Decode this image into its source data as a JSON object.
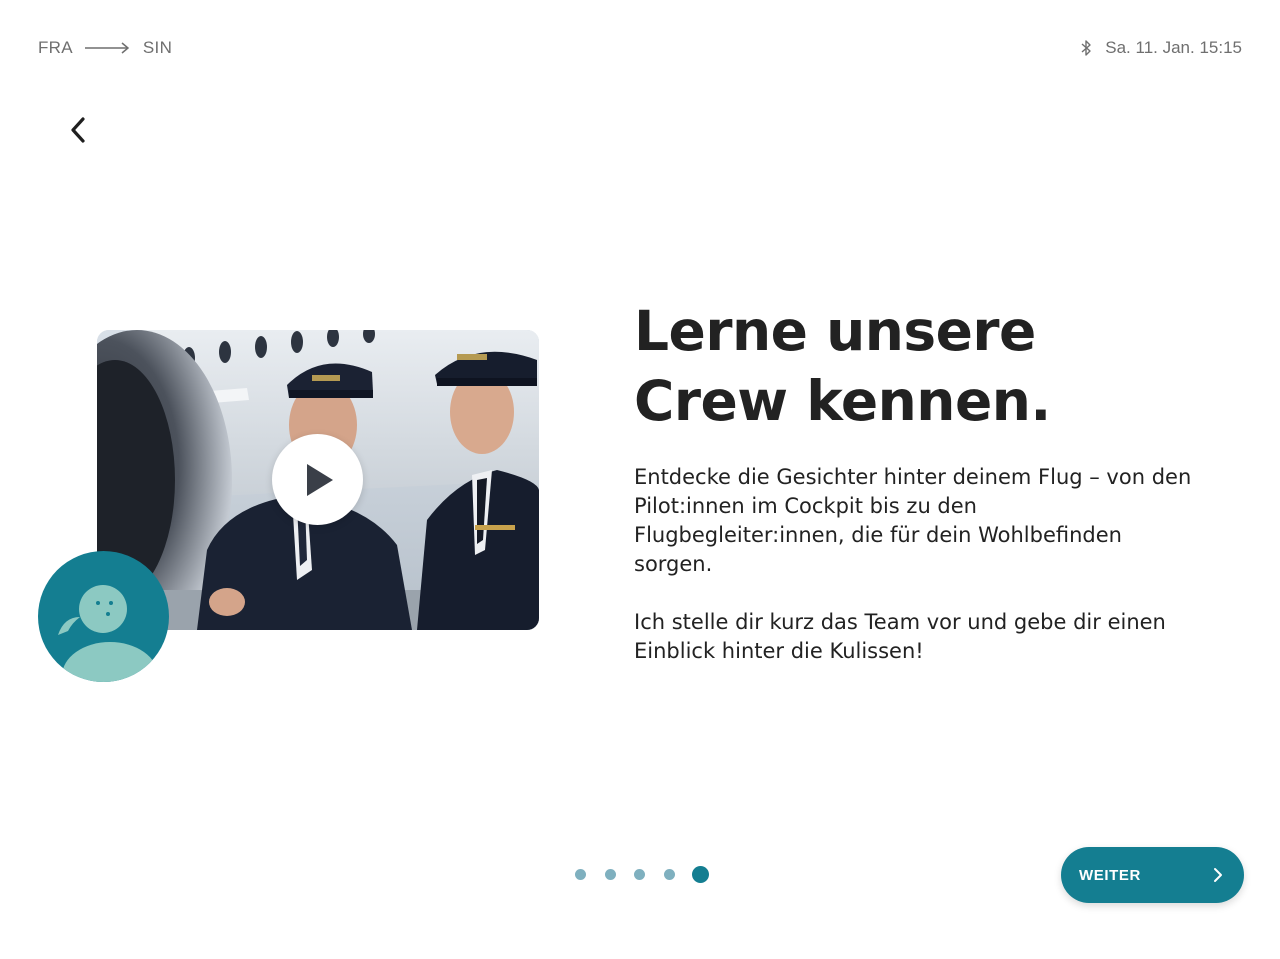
{
  "header": {
    "origin": "FRA",
    "destination": "SIN",
    "datetime": "Sa. 11. Jan. 15:15"
  },
  "icons": {
    "back": "chevron-left-icon",
    "route_arrow": "arrow-right-icon",
    "bluetooth": "bluetooth-icon",
    "play": "play-icon",
    "next": "chevron-right-icon",
    "avatar": "assistant-avatar-icon"
  },
  "main": {
    "headline_line1": "Lerne unsere",
    "headline_line2": "Crew kennen.",
    "paragraph1": "Entdecke die Gesichter hinter deinem Flug – von den Pilot:innen im Cockpit bis zu den Flugbegleiter:innen, die für dein Wohlbefinden sorgen.",
    "paragraph2": "Ich stelle dir kurz das Team vor und gebe dir einen Einblick hinter die Kulissen!"
  },
  "pager": {
    "total": 5,
    "active_index": 4
  },
  "footer": {
    "next_label": "WEITER"
  },
  "colors": {
    "accent": "#147e91",
    "accent_light": "#7fb0bf",
    "avatar_body": "#8cc9c2",
    "text": "#222222",
    "muted": "#6f6f6f"
  }
}
